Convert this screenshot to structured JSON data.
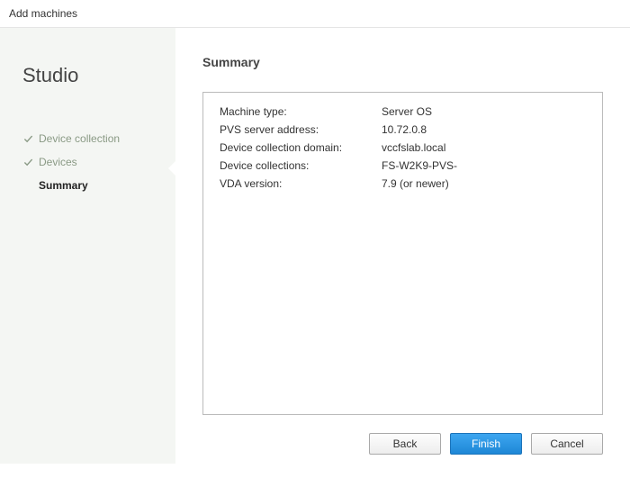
{
  "window": {
    "title": "Add machines"
  },
  "sidebar": {
    "brand": "Studio",
    "steps": [
      {
        "label": "Device collection",
        "done": true
      },
      {
        "label": "Devices",
        "done": true
      },
      {
        "label": "Summary",
        "current": true
      }
    ]
  },
  "content": {
    "title": "Summary",
    "rows": [
      {
        "label": "Machine type:",
        "value": "Server OS"
      },
      {
        "label": "PVS server address:",
        "value": "10.72.0.8"
      },
      {
        "label": "Device collection domain:",
        "value": "vccfslab.local"
      },
      {
        "label": "Device collections:",
        "value": "FS-W2K9-PVS-"
      },
      {
        "label": "VDA version:",
        "value": "7.9 (or newer)"
      }
    ]
  },
  "buttons": {
    "back": "Back",
    "finish": "Finish",
    "cancel": "Cancel"
  }
}
